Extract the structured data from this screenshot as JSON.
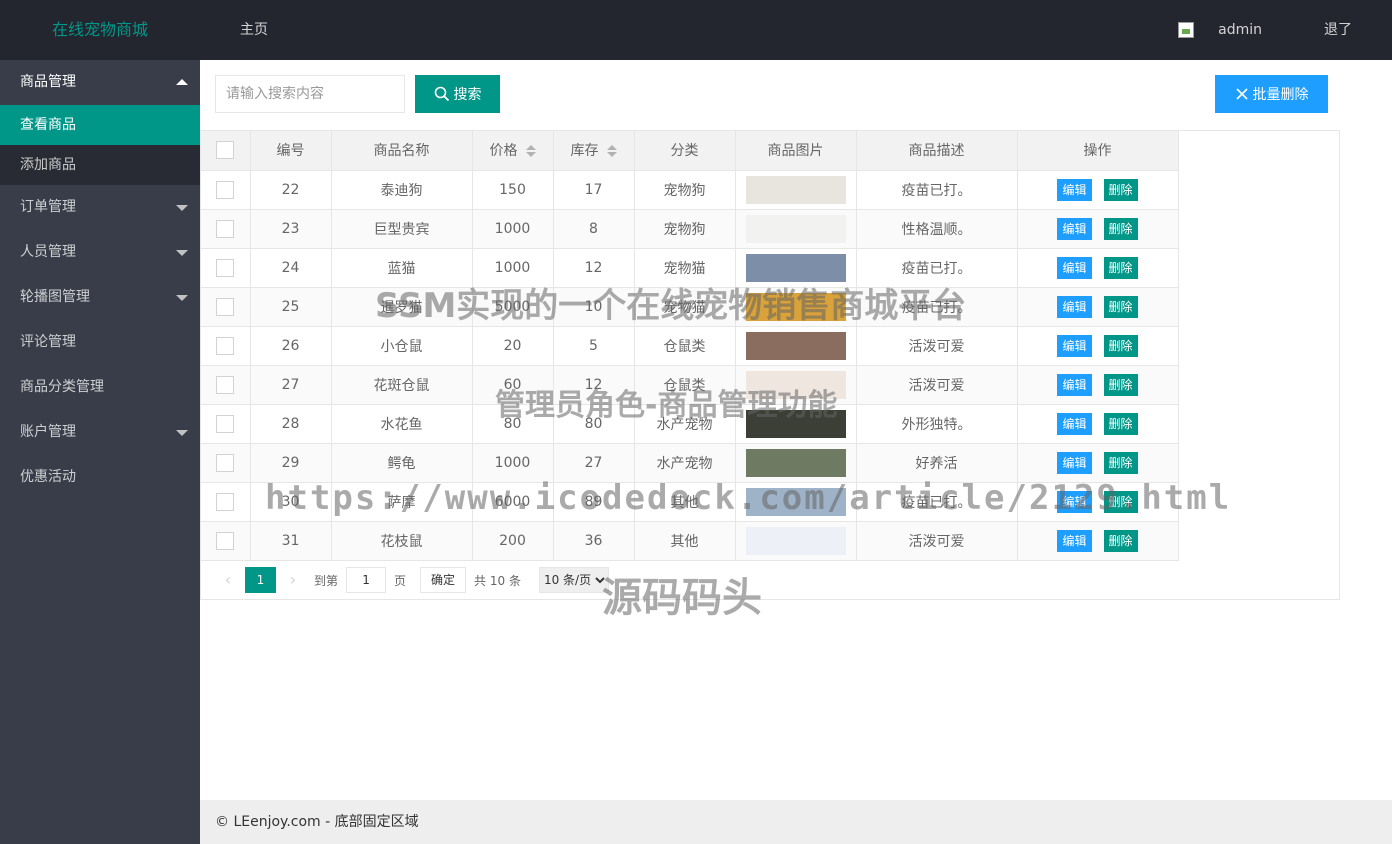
{
  "header": {
    "logo": "在线宠物商城",
    "nav_home": "主页",
    "username": "admin",
    "logout": "退了"
  },
  "sidebar": {
    "group_goods": "商品管理",
    "sub_view": "查看商品",
    "sub_add": "添加商品",
    "items": [
      "订单管理",
      "人员管理",
      "轮播图管理",
      "评论管理",
      "商品分类管理",
      "账户管理",
      "优惠活动"
    ]
  },
  "toolbar": {
    "search_placeholder": "请输入搜索内容",
    "search_label": "搜索",
    "batch_delete_label": "批量删除"
  },
  "table": {
    "headers": [
      "编号",
      "商品名称",
      "价格",
      "库存",
      "分类",
      "商品图片",
      "商品描述",
      "操作"
    ],
    "edit_label": "编辑",
    "delete_label": "删除",
    "rows": [
      {
        "id": "22",
        "name": "泰迪狗",
        "price": "150",
        "stock": "17",
        "category": "宠物狗",
        "desc": "疫苗已打。",
        "img_color": "#e8e4de"
      },
      {
        "id": "23",
        "name": "巨型贵宾",
        "price": "1000",
        "stock": "8",
        "category": "宠物狗",
        "desc": "性格温顺。",
        "img_color": "#f2f2f0"
      },
      {
        "id": "24",
        "name": "蓝猫",
        "price": "1000",
        "stock": "12",
        "category": "宠物猫",
        "desc": "疫苗已打。",
        "img_color": "#7d8fa8"
      },
      {
        "id": "25",
        "name": "暹罗猫",
        "price": "5000",
        "stock": "10",
        "category": "宠物猫",
        "desc": "疫苗已打。",
        "img_color": "#d9a23a"
      },
      {
        "id": "26",
        "name": "小仓鼠",
        "price": "20",
        "stock": "5",
        "category": "仓鼠类",
        "desc": "活泼可爱",
        "img_color": "#8a6d5e"
      },
      {
        "id": "27",
        "name": "花斑仓鼠",
        "price": "60",
        "stock": "12",
        "category": "仓鼠类",
        "desc": "活泼可爱",
        "img_color": "#f0e6e0"
      },
      {
        "id": "28",
        "name": "水花鱼",
        "price": "80",
        "stock": "80",
        "category": "水产宠物",
        "desc": "外形独特。",
        "img_color": "#3b3f36"
      },
      {
        "id": "29",
        "name": "鳄龟",
        "price": "1000",
        "stock": "27",
        "category": "水产宠物",
        "desc": "好养活",
        "img_color": "#6f7a63"
      },
      {
        "id": "30",
        "name": "萨摩",
        "price": "6000",
        "stock": "89",
        "category": "其他",
        "desc": "疫苗已打。",
        "img_color": "#9fb3c8"
      },
      {
        "id": "31",
        "name": "花枝鼠",
        "price": "200",
        "stock": "36",
        "category": "其他",
        "desc": "活泼可爱",
        "img_color": "#eef0f8"
      }
    ]
  },
  "pager": {
    "prev": "‹",
    "current": "1",
    "next": "›",
    "goto_label": "到第",
    "goto_value": "1",
    "page_unit": "页",
    "ok": "确定",
    "total": "共 10 条",
    "page_size": "10 条/页"
  },
  "footer": {
    "text": "© LEenjoy.com - 底部固定区域"
  },
  "watermarks": {
    "line1": "SSM实现的一个在线宠物销售商城平台",
    "line2": "管理员角色-商品管理功能",
    "line3": "https://www.icodedock.com/article/2129.html",
    "line4": "源码码头"
  },
  "colors": {
    "header_bg": "#23262e",
    "sidebar_bg": "#393d49",
    "accent_green": "#009688",
    "accent_blue": "#1e9fff"
  }
}
